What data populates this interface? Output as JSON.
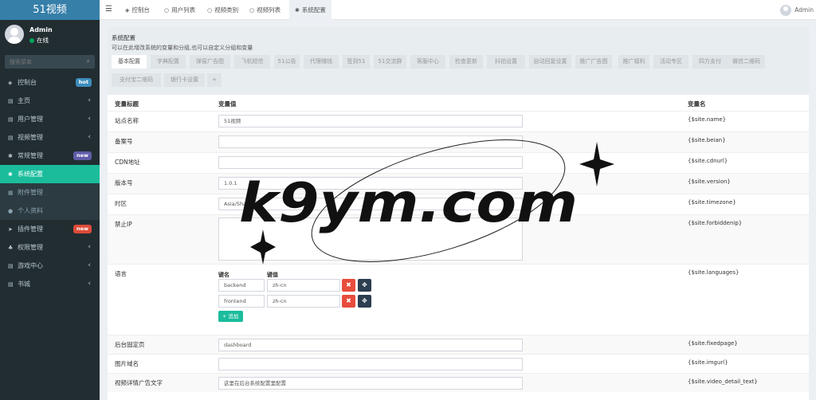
{
  "app": {
    "logo": "51视频"
  },
  "user": {
    "name": "Admin",
    "status": "在线"
  },
  "search": {
    "placeholder": "搜索菜单"
  },
  "menu": [
    {
      "label": "控制台",
      "icon": "dashboard-icon",
      "glyph": "◈",
      "badge": "hot",
      "badge_color": "#3c8dbc"
    },
    {
      "label": "主页",
      "icon": "list-icon",
      "glyph": "▤",
      "chev": "‹"
    },
    {
      "label": "用户管理",
      "icon": "list-icon",
      "glyph": "▤",
      "chev": "‹"
    },
    {
      "label": "视频管理",
      "icon": "list-icon",
      "glyph": "▤",
      "chev": "‹"
    },
    {
      "label": "常规管理",
      "icon": "cogs-icon",
      "glyph": "✱",
      "badge": "new",
      "badge_color": "#605ca8"
    },
    {
      "label": "系统配置",
      "icon": "gear-icon",
      "glyph": "✱",
      "active": true
    },
    {
      "label": "附件管理",
      "icon": "file-icon",
      "glyph": "▦",
      "sub": true
    },
    {
      "label": "个人资料",
      "icon": "user-icon",
      "glyph": "●",
      "sub": true
    },
    {
      "label": "插件管理",
      "icon": "rocket-icon",
      "glyph": "➤",
      "badge": "new",
      "badge_color": "#dd4b39"
    },
    {
      "label": "权限管理",
      "icon": "group-icon",
      "glyph": "♣",
      "chev": "‹"
    },
    {
      "label": "游戏中心",
      "icon": "list-icon",
      "glyph": "▤",
      "chev": "‹"
    },
    {
      "label": "书城",
      "icon": "list-icon",
      "glyph": "▤",
      "chev": "‹"
    }
  ],
  "topbar": {
    "tabs": [
      {
        "label": "控制台",
        "icon": "dashboard-icon",
        "glyph": "◈"
      },
      {
        "label": "用户列表",
        "icon": "circle-icon",
        "glyph": "○"
      },
      {
        "label": "视频类别",
        "icon": "circle-icon",
        "glyph": "○"
      },
      {
        "label": "视频列表",
        "icon": "circle-icon",
        "glyph": "○"
      },
      {
        "label": "系统配置",
        "icon": "gear-icon",
        "glyph": "✱",
        "active": true
      }
    ],
    "user": "Admin"
  },
  "config": {
    "title": "系统配置",
    "description": "可以在此增改系统的变量和分组,也可以自定义分组和变量",
    "tabs_row1": [
      "基本配置",
      "字典配置",
      "弹窗广告图",
      "飞机短信",
      "51公告",
      "代理赚钱",
      "签到51",
      "51交流群",
      "客服中心",
      "检查更新",
      "抖拍设置",
      "自动回复设置",
      "推广广告图",
      "推广福利",
      "活动专区",
      "四方支付",
      "微信二维码"
    ],
    "tabs_row2": [
      "支付宝二维码",
      "银行卡设置",
      "+"
    ]
  },
  "table": {
    "headers": {
      "title": "变量标题",
      "value": "变量值",
      "name": "变量名"
    },
    "rows": [
      {
        "label": "站点名称",
        "value": "51视频",
        "var": "{$site.name}"
      },
      {
        "label": "备案号",
        "value": "",
        "var": "{$site.beian}"
      },
      {
        "label": "CDN地址",
        "value": "",
        "var": "{$site.cdnurl}"
      },
      {
        "label": "版本号",
        "value": "1.0.1",
        "var": "{$site.version}"
      },
      {
        "label": "时区",
        "value": "Asia/Shanghai",
        "var": "{$site.timezone}"
      },
      {
        "label": "禁止IP",
        "value": "",
        "var": "{$site.forbiddenip}"
      },
      {
        "label": "语言",
        "var": "{$site.languages}",
        "key_header": "键名",
        "val_header": "键值",
        "pairs": [
          {
            "key": "backend",
            "val": "zh-cn"
          },
          {
            "key": "frontend",
            "val": "zh-cn"
          }
        ],
        "add_label": "+ 追加"
      },
      {
        "label": "后台固定页",
        "value": "dashboard",
        "var": "{$site.fixedpage}"
      },
      {
        "label": "图片域名",
        "value": "",
        "var": "{$site.imgurl}"
      },
      {
        "label": "视频详情广告文字",
        "value": "这里在后台系统配置里配置",
        "var": "{$site.video_detail_text}"
      }
    ]
  },
  "watermark": {
    "text": "k9ym.com"
  },
  "colors": {
    "sidebar": "#222d32",
    "accent": "#1abc9c",
    "delete": "#e74c3c",
    "dark_btn": "#2c3e50"
  }
}
